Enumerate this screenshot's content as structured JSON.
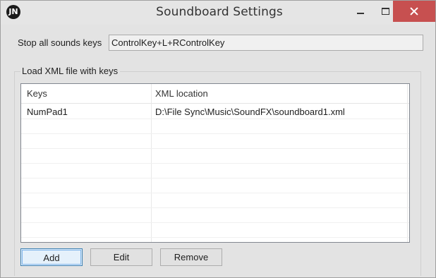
{
  "window": {
    "title": "Soundboard Settings",
    "app_icon_text": "JN"
  },
  "titlebar_buttons": {
    "minimize": "minimize-icon",
    "maximize": "maximize-icon",
    "close": "close-icon",
    "close_color": "#c75050"
  },
  "stop_keys": {
    "label": "Stop all sounds keys",
    "value": "ControlKey+L+RControlKey"
  },
  "xml_group": {
    "legend": "Load XML file with keys",
    "columns": [
      "Keys",
      "XML location"
    ],
    "rows": [
      {
        "keys": "NumPad1",
        "location": "D:\\File Sync\\Music\\SoundFX\\soundboard1.xml"
      }
    ]
  },
  "buttons": {
    "add": "Add",
    "edit": "Edit",
    "remove": "Remove"
  }
}
